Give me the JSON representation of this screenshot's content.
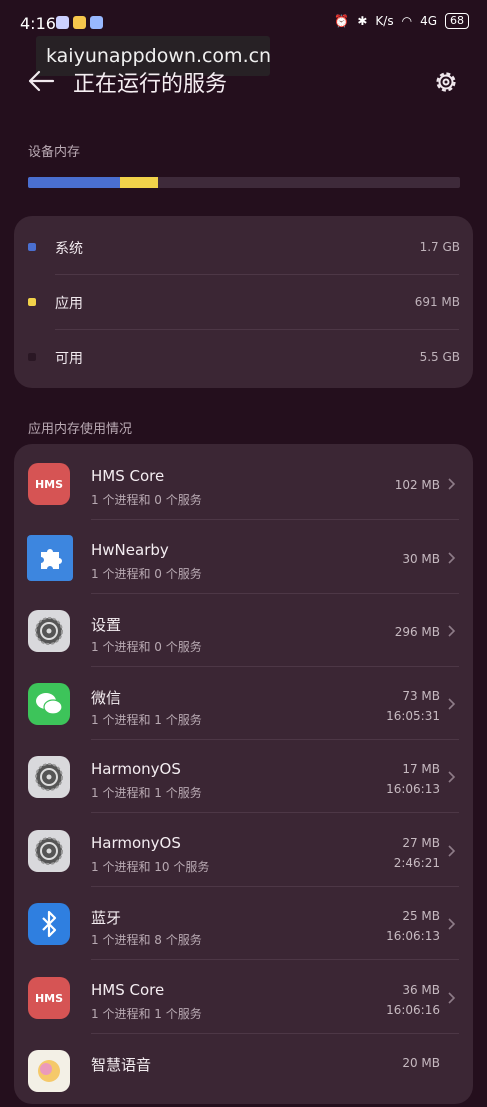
{
  "status": {
    "time": "4:16",
    "net_unit": "K/s",
    "signal": "4G",
    "battery": "68"
  },
  "watermark": "kaiyunappdown.com.cn",
  "header": {
    "title": "正在运行的服务"
  },
  "device_memory": {
    "label": "设备内存",
    "usage": [
      {
        "name": "系统",
        "value": "1.7 GB",
        "color": "#4a6fd0"
      },
      {
        "name": "应用",
        "value": "691 MB",
        "color": "#f1d24a"
      },
      {
        "name": "可用",
        "value": "5.5 GB",
        "color": "#3e2a3a"
      }
    ]
  },
  "app_memory": {
    "label": "应用内存使用情况",
    "apps": [
      {
        "name": "HMS Core",
        "desc": "1 个进程和 0 个服务",
        "size": "102 MB",
        "time": "",
        "icon": "hms-core-icon"
      },
      {
        "name": "HwNearby",
        "desc": "1 个进程和 0 个服务",
        "size": "30 MB",
        "time": "",
        "icon": "puzzle-icon"
      },
      {
        "name": "设置",
        "desc": "1 个进程和 0 个服务",
        "size": "296 MB",
        "time": "",
        "icon": "settings-gear-icon"
      },
      {
        "name": "微信",
        "desc": "1 个进程和 1 个服务",
        "size": "73 MB",
        "time": "16:05:31",
        "icon": "wechat-icon"
      },
      {
        "name": "HarmonyOS",
        "desc": "1 个进程和 1 个服务",
        "size": "17 MB",
        "time": "16:06:13",
        "icon": "settings-gear-icon"
      },
      {
        "name": "HarmonyOS",
        "desc": "1 个进程和 10 个服务",
        "size": "27 MB",
        "time": "2:46:21",
        "icon": "settings-gear-icon"
      },
      {
        "name": "蓝牙",
        "desc": "1 个进程和 8 个服务",
        "size": "25 MB",
        "time": "16:06:13",
        "icon": "bluetooth-icon"
      },
      {
        "name": "HMS Core",
        "desc": "1 个进程和 1 个服务",
        "size": "36 MB",
        "time": "16:06:16",
        "icon": "hms-core-icon"
      },
      {
        "name": "智慧语音",
        "desc": "",
        "size": "20 MB",
        "time": "",
        "icon": "voice-assistant-icon"
      }
    ]
  }
}
